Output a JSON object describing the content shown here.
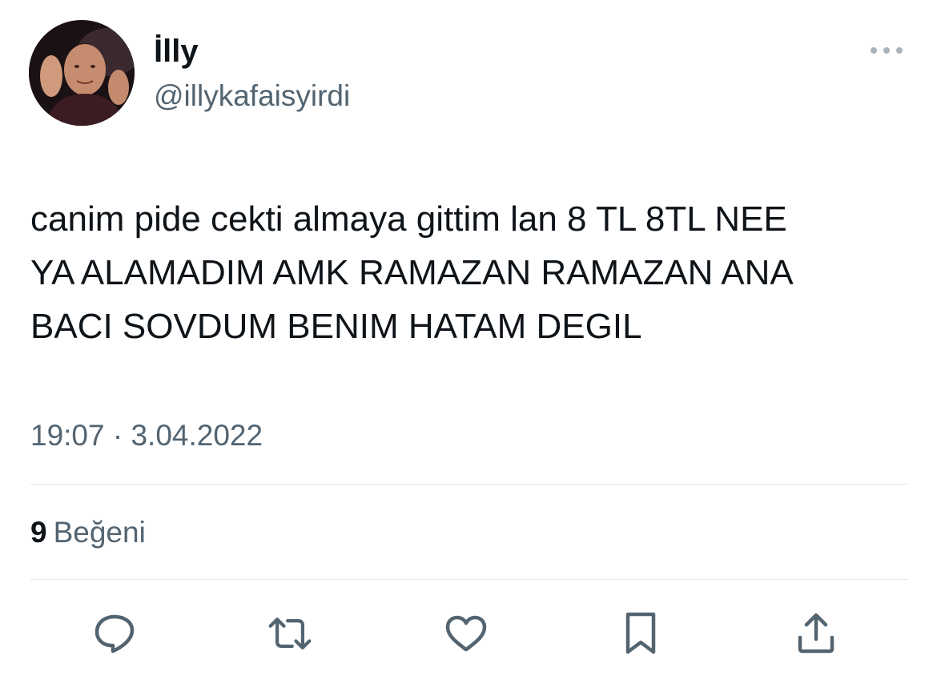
{
  "author": {
    "display_name": "İlly",
    "handle": "@illykafaisyirdi"
  },
  "tweet": {
    "text_lines": [
      "canim pide cekti almaya gittim lan 8 TL 8TL NEE",
      "YA ALAMADIM AMK RAMAZAN RAMAZAN ANA",
      "BACI SOVDUM BENIM HATAM DEGIL"
    ],
    "timestamp": "19:07 · 3.04.2022"
  },
  "stats": {
    "likes_count": "9",
    "likes_label": "Beğeni"
  },
  "icons": {
    "more": "more-horizontal-icon",
    "reply": "reply-icon",
    "retweet": "retweet-icon",
    "like": "heart-icon",
    "bookmark": "bookmark-icon",
    "share": "share-icon"
  },
  "colors": {
    "text_primary": "#0f1419",
    "text_secondary": "#536471",
    "divider": "#e1e6ea"
  }
}
